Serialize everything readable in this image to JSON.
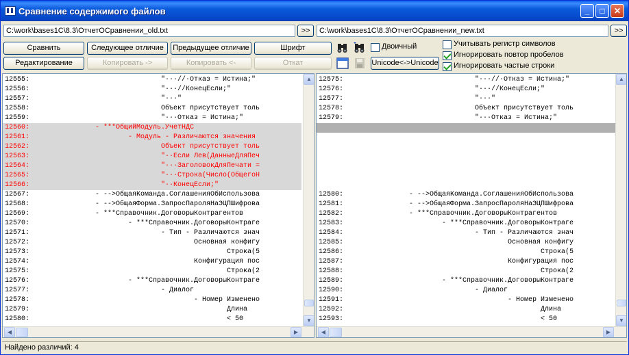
{
  "window": {
    "title": "Сравнение содержимого файлов",
    "controls": {
      "minimize": "_",
      "maximize": "□",
      "close": "✕"
    }
  },
  "paths": {
    "left": "C:\\work\\bases1C\\8.3\\ОтчетОСравнении_old.txt",
    "right": "C:\\work\\bases1C\\8.3\\ОтчетОСравнении_new.txt",
    "browse_label": ">>"
  },
  "toolbar": {
    "compare": "Сравнить",
    "next_diff": "Следующее отличие",
    "prev_diff": "Предыдущее отличие",
    "font": "Шрифт",
    "edit": "Редактирование",
    "copy_right": "Копировать ->",
    "copy_left": "Копировать <-",
    "undo": "Откат",
    "binary": "Двоичный",
    "unicode": "Unicode<->Unicode",
    "case_sensitive": "Учитывать регистр символов",
    "ignore_spaces": "Игнорировать повтор пробелов",
    "ignore_frequent": "Игнорировать частые строки"
  },
  "checkboxes": {
    "binary": false,
    "case_sensitive": false,
    "ignore_spaces": true,
    "ignore_frequent": true
  },
  "left_lines": [
    {
      "n": "12555:",
      "t": "\"···//·Отказ = Истина;\"",
      "i": 38,
      "s": ""
    },
    {
      "n": "12556:",
      "t": "\"···//КонецЕсли;\"",
      "i": 38,
      "s": ""
    },
    {
      "n": "12557:",
      "t": "\"···\"",
      "i": 38,
      "s": ""
    },
    {
      "n": "12558:",
      "t": "Объект присутствует толь",
      "i": 38,
      "s": ""
    },
    {
      "n": "12559:",
      "t": "\"···Отказ = Истина;\"",
      "i": 38,
      "s": ""
    },
    {
      "n": "12560:",
      "t": "- ***ОбщийМодуль.УчетНДС",
      "i": 22,
      "s": "diff"
    },
    {
      "n": "12561:",
      "t": "- Модуль - Различаются значения",
      "i": 30,
      "s": "diff"
    },
    {
      "n": "12562:",
      "t": "Объект присутствует толь",
      "i": 38,
      "s": "diff"
    },
    {
      "n": "12563:",
      "t": "\"··Если Лев(ДанныеДляПеч",
      "i": 38,
      "s": "diff"
    },
    {
      "n": "12564:",
      "t": "\"···ЗаголовокДляПечати =",
      "i": 38,
      "s": "diff"
    },
    {
      "n": "12565:",
      "t": "\"···Строка(Число(ОбщегоН",
      "i": 38,
      "s": "diff"
    },
    {
      "n": "12566:",
      "t": "\"··КонецЕсли;\"",
      "i": 38,
      "s": "diff"
    },
    {
      "n": "12567:",
      "t": "- -->ОбщаяКоманда.СоглашенияОбИспользова",
      "i": 22,
      "s": ""
    },
    {
      "n": "12568:",
      "t": "- -->ОбщаяФорма.ЗапросПароляНаЭЦПШифрова",
      "i": 22,
      "s": ""
    },
    {
      "n": "12569:",
      "t": "- ***Справочник.ДоговорыКонтрагентов",
      "i": 22,
      "s": ""
    },
    {
      "n": "12570:",
      "t": "- ***Справочник.ДоговорыКонтраге",
      "i": 30,
      "s": ""
    },
    {
      "n": "12571:",
      "t": "- Тип - Различаются знач",
      "i": 38,
      "s": ""
    },
    {
      "n": "12572:",
      "t": "Основная конфигу",
      "i": 46,
      "s": ""
    },
    {
      "n": "12573:",
      "t": "Строка(5",
      "i": 54,
      "s": ""
    },
    {
      "n": "12574:",
      "t": "Конфигурация пос",
      "i": 46,
      "s": ""
    },
    {
      "n": "12575:",
      "t": "Строка(2",
      "i": 54,
      "s": ""
    },
    {
      "n": "12576:",
      "t": "- ***Справочник.ДоговорыКонтраге",
      "i": 30,
      "s": ""
    },
    {
      "n": "12577:",
      "t": "- Диалог",
      "i": 38,
      "s": ""
    },
    {
      "n": "12578:",
      "t": "- Номер Изменено",
      "i": 46,
      "s": ""
    },
    {
      "n": "12579:",
      "t": "Длина",
      "i": 54,
      "s": ""
    },
    {
      "n": "12580:",
      "t": "< 50",
      "i": 54,
      "s": ""
    }
  ],
  "right_lines": [
    {
      "n": "12575:",
      "t": "\"···//·Отказ = Истина;\"",
      "i": 38,
      "s": ""
    },
    {
      "n": "12576:",
      "t": "\"···//КонецЕсли;\"",
      "i": 38,
      "s": ""
    },
    {
      "n": "12577:",
      "t": "\"···\"",
      "i": 38,
      "s": ""
    },
    {
      "n": "12578:",
      "t": "Объект присутствует толь",
      "i": 38,
      "s": ""
    },
    {
      "n": "12579:",
      "t": "\"···Отказ = Истина;\"",
      "i": 38,
      "s": ""
    },
    {
      "n": "",
      "t": "",
      "i": 0,
      "s": "gap"
    },
    {
      "n": "",
      "t": "",
      "i": 0,
      "s": ""
    },
    {
      "n": "",
      "t": "",
      "i": 0,
      "s": ""
    },
    {
      "n": "",
      "t": "",
      "i": 0,
      "s": ""
    },
    {
      "n": "",
      "t": "",
      "i": 0,
      "s": ""
    },
    {
      "n": "",
      "t": "",
      "i": 0,
      "s": ""
    },
    {
      "n": "",
      "t": "",
      "i": 0,
      "s": ""
    },
    {
      "n": "12580:",
      "t": "- -->ОбщаяКоманда.СоглашенияОбИспользова",
      "i": 22,
      "s": ""
    },
    {
      "n": "12581:",
      "t": "- -->ОбщаяФорма.ЗапросПароляНаЭЦПШифрова",
      "i": 22,
      "s": ""
    },
    {
      "n": "12582:",
      "t": "- ***Справочник.ДоговорыКонтрагентов",
      "i": 22,
      "s": ""
    },
    {
      "n": "12583:",
      "t": "- ***Справочник.ДоговорыКонтраге",
      "i": 30,
      "s": ""
    },
    {
      "n": "12584:",
      "t": "- Тип - Различаются знач",
      "i": 38,
      "s": ""
    },
    {
      "n": "12585:",
      "t": "Основная конфигу",
      "i": 46,
      "s": ""
    },
    {
      "n": "12586:",
      "t": "Строка(5",
      "i": 54,
      "s": ""
    },
    {
      "n": "12587:",
      "t": "Конфигурация пос",
      "i": 46,
      "s": ""
    },
    {
      "n": "12588:",
      "t": "Строка(2",
      "i": 54,
      "s": ""
    },
    {
      "n": "12589:",
      "t": "- ***Справочник.ДоговорыКонтраге",
      "i": 30,
      "s": ""
    },
    {
      "n": "12590:",
      "t": "- Диалог",
      "i": 38,
      "s": ""
    },
    {
      "n": "12591:",
      "t": "- Номер Изменено",
      "i": 46,
      "s": ""
    },
    {
      "n": "12592:",
      "t": "Длина",
      "i": 54,
      "s": ""
    },
    {
      "n": "12593:",
      "t": "< 50",
      "i": 54,
      "s": ""
    }
  ],
  "status": {
    "text": "Найдено различий: 4"
  }
}
